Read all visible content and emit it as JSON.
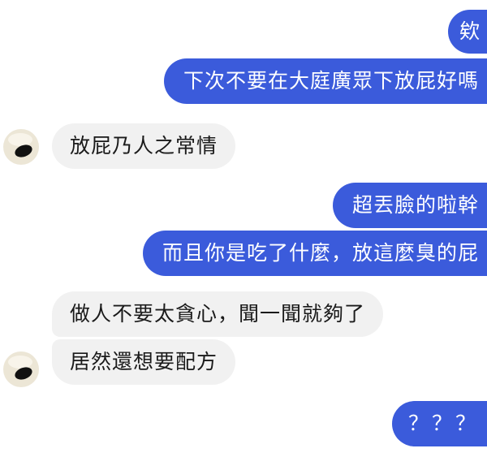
{
  "messages": [
    {
      "side": "out",
      "text": "欸"
    },
    {
      "side": "out",
      "text": "下次不要在大庭廣眾下放屁好嗎"
    },
    {
      "side": "in",
      "text": "放屁乃人之常情"
    },
    {
      "side": "out",
      "text": "超丟臉的啦幹"
    },
    {
      "side": "out",
      "text": "而且你是吃了什麼，放這麼臭的屁"
    },
    {
      "side": "in",
      "text": "做人不要太貪心，聞一聞就夠了"
    },
    {
      "side": "in",
      "text": "居然還想要配方"
    },
    {
      "side": "out",
      "text": "？？？"
    }
  ],
  "colors": {
    "outgoing_bubble": "#3b5bdb",
    "incoming_bubble": "#f1f1f1",
    "background": "#ffffff"
  },
  "icons": {
    "contact_avatar": "avatar-icon"
  }
}
